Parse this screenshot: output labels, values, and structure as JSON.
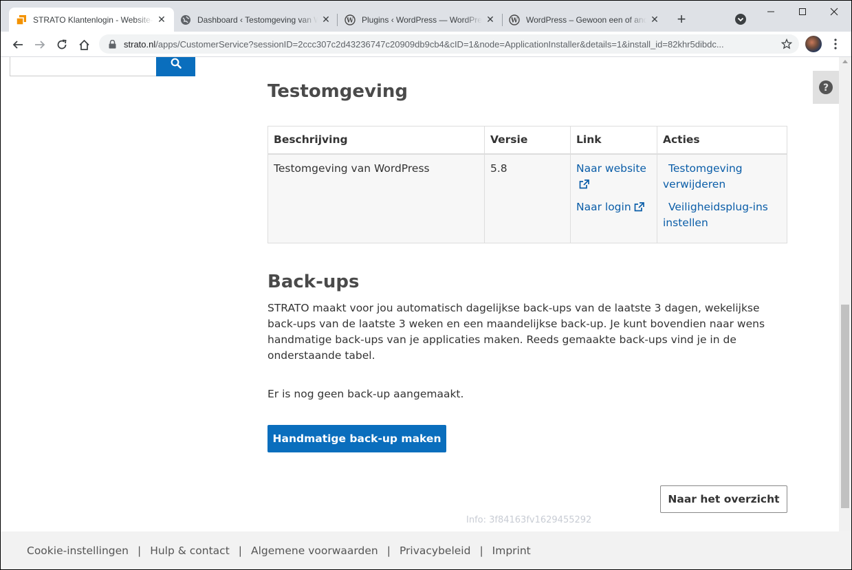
{
  "browser": {
    "tabs": [
      {
        "title": "STRATO Klantenlogin - Website-a",
        "icon": "strato-icon",
        "active": true
      },
      {
        "title": "Dashboard ‹ Testomgeving van W",
        "icon": "globe-icon",
        "active": false
      },
      {
        "title": "Plugins ‹ WordPress — WordPres",
        "icon": "wordpress-icon",
        "active": false
      },
      {
        "title": "WordPress – Gewoon een of and",
        "icon": "wordpress-icon",
        "active": false
      }
    ],
    "url_host": "strato.nl",
    "url_path": "/apps/CustomerService?sessionID=2ccc307c2d43236747c20909db9cb4&cID=1&node=ApplicationInstaller&details=1&install_id=82khr5dibdc..."
  },
  "testomgeving": {
    "heading": "Testomgeving",
    "columns": [
      "Beschrijving",
      "Versie",
      "Link",
      "Acties"
    ],
    "row": {
      "description": "Testomgeving van WordPress",
      "version": "5.8",
      "links": [
        "Naar website",
        "Naar login"
      ],
      "actions": [
        "Testomgeving verwijderen",
        "Veiligheidsplug-ins instellen"
      ]
    }
  },
  "backups": {
    "heading": "Back-ups",
    "description": "STRATO maakt voor jou automatisch dagelijkse back-ups van de laatste 3 dagen, wekelijkse back-ups van de laatste 3 weken en een maandelijkse back-up. Je kunt bovendien naar wens handmatige back-ups van je applicaties maken. Reeds gemaakte back-ups vind je in de onderstaande tabel.",
    "empty_text": "Er is nog geen back-up aangemaakt.",
    "create_button": "Handmatige back-up maken"
  },
  "overview_button": "Naar het overzicht",
  "info": "Info: 3f84163fv1629455292",
  "footer": {
    "links": [
      "Cookie-instellingen",
      "Hulp & contact",
      "Algemene voorwaarden",
      "Privacybeleid",
      "Imprint"
    ],
    "separator": "|"
  },
  "colors": {
    "primary": "#0a6ebd",
    "link": "#0a5da8",
    "heading": "#4a4a4a",
    "strato_orange": "#f39200"
  }
}
